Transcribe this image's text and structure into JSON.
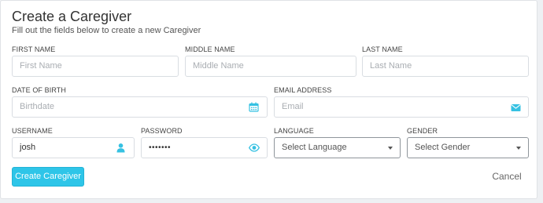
{
  "form": {
    "title": "Create a Caregiver",
    "subtitle": "Fill out the fields below to create a new Caregiver"
  },
  "fields": {
    "first_name": {
      "label": "FIRST NAME",
      "placeholder": "First Name",
      "value": ""
    },
    "middle_name": {
      "label": "MIDDLE NAME",
      "placeholder": "Middle Name",
      "value": ""
    },
    "last_name": {
      "label": "LAST NAME",
      "placeholder": "Last Name",
      "value": ""
    },
    "date_of_birth": {
      "label": "DATE OF BIRTH",
      "placeholder": "Birthdate",
      "value": "",
      "icon": "calendar-icon"
    },
    "email": {
      "label": "EMAIL ADDRESS",
      "placeholder": "Email",
      "value": "",
      "icon": "envelope-icon"
    },
    "username": {
      "label": "USERNAME",
      "placeholder": "",
      "value": "josh",
      "icon": "user-icon"
    },
    "password": {
      "label": "PASSWORD",
      "placeholder": "",
      "value": "•••••••",
      "icon": "eye-icon"
    },
    "language": {
      "label": "LANGUAGE",
      "selected": "Select Language"
    },
    "gender": {
      "label": "GENDER",
      "selected": "Select Gender"
    }
  },
  "actions": {
    "submit_label": "Create Caregiver",
    "cancel_label": "Cancel"
  },
  "colors": {
    "accent": "#2ec5e8",
    "icon": "#36c1e2"
  }
}
